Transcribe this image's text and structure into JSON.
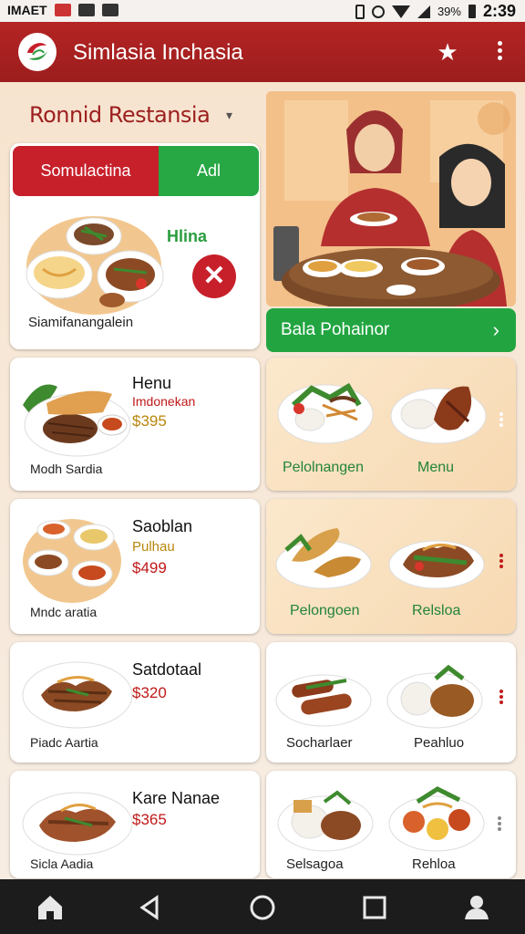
{
  "status_bar": {
    "left_text": "IMAET",
    "battery": "39%",
    "time": "2:39"
  },
  "app_bar": {
    "title": "Simlasia Inchasia",
    "icons": [
      "logo-icon",
      "star-icon",
      "more-vert-icon"
    ]
  },
  "restaurant": {
    "title": "Ronnid Restansia"
  },
  "feature_card": {
    "tab_active": "Somulactina",
    "tab_other": "Adl",
    "label": "Hlina",
    "caption": "Siamifanangalein"
  },
  "promo": {
    "label": "Bala Pohainor"
  },
  "menu_items": [
    {
      "title": "Henu",
      "subtitle": "Imdonekan",
      "price": "$395",
      "caption": "Modh Sardia",
      "subtitle_color": "#c01818"
    },
    {
      "title": "Saoblan",
      "subtitle": "Pulhau",
      "price": "$499",
      "caption": "Mndc aratia",
      "subtitle_color": "#b8860b"
    },
    {
      "title": "Satdotaal",
      "subtitle": "",
      "price": "$320",
      "caption": "Piadc Aartia",
      "subtitle_color": ""
    },
    {
      "title": "Kare Nanae",
      "subtitle": "",
      "price": "$365",
      "caption": "Sicla Aadia",
      "subtitle_color": ""
    }
  ],
  "right_cards": [
    {
      "left_label": "Pelolnangen",
      "right_label": "Menu",
      "label_style": "green"
    },
    {
      "left_label": "Pelongoen",
      "right_label": "Relsloa",
      "label_style": "green"
    },
    {
      "left_label": "Socharlaer",
      "right_label": "Peahluo",
      "label_style": "dark"
    },
    {
      "left_label": "Selsagoa",
      "right_label": "Rehloa",
      "label_style": "dark"
    }
  ],
  "nav_bar": [
    "home-icon",
    "back-icon",
    "home-circle-icon",
    "recents-icon",
    "profile-icon"
  ],
  "colors": {
    "primary_red": "#b52424",
    "accent_green": "#28a745"
  }
}
